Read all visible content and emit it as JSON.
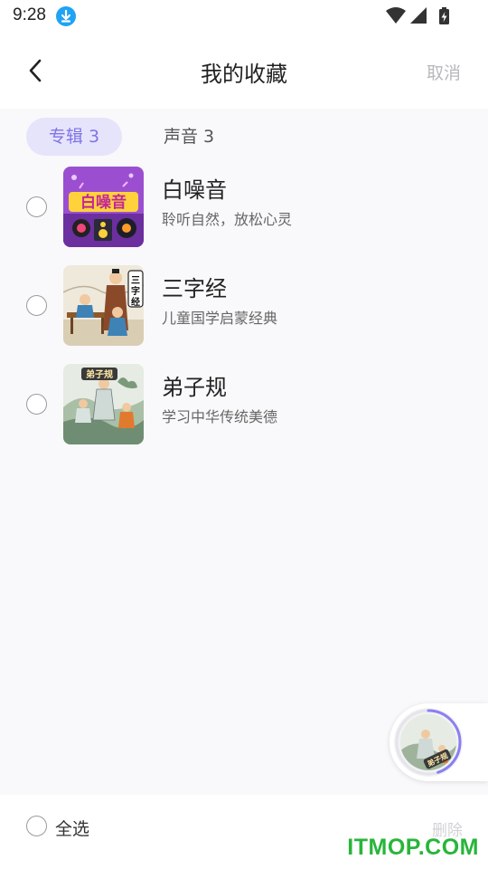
{
  "status_bar": {
    "time": "9:28",
    "download_icon": "download-icon",
    "wifi_icon": "wifi-icon",
    "signal_icon": "signal-icon",
    "battery_icon": "battery-charging-icon"
  },
  "header": {
    "back_icon": "chevron-left-icon",
    "title": "我的收藏",
    "cancel_label": "取消"
  },
  "tabs": [
    {
      "label": "专辑 3",
      "active": true
    },
    {
      "label": "声音 3",
      "active": false
    }
  ],
  "albums": [
    {
      "title": "白噪音",
      "subtitle": "聆听自然，放松心灵",
      "cover_text": "白噪音"
    },
    {
      "title": "三字经",
      "subtitle": "儿童国学启蒙经典",
      "cover_text": "三字经"
    },
    {
      "title": "弟子规",
      "subtitle": "学习中华传统美德",
      "cover_text": "弟子规"
    }
  ],
  "mini_player": {
    "cover_text": "弟子规",
    "progress": 0.45
  },
  "footer": {
    "select_all_label": "全选",
    "delete_label": "删除"
  },
  "watermark": "ITMOP.COM",
  "colors": {
    "accent": "#7f74e8",
    "accent_bg": "#e6e4fb",
    "watermark": "#28b53a",
    "download_badge": "#1fa3f5"
  }
}
